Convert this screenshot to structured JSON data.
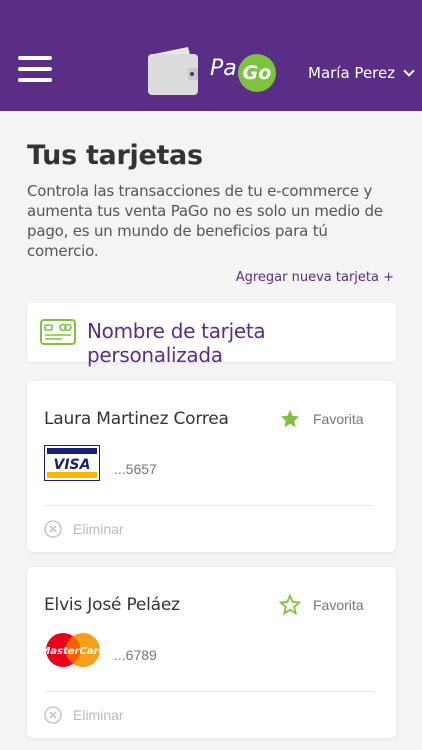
{
  "header": {
    "brand_pa": "Pa",
    "brand_go": "Go",
    "user_name": "María Perez"
  },
  "page": {
    "title": "Tus tarjetas",
    "intro": "Controla las transacciones de tu e-commerce y aumenta tus venta PaGo no es solo un medio de pago, es un mundo de beneficios para tú comercio.",
    "add_card_label": "Agregar nueva tarjeta +"
  },
  "section": {
    "label": "Nombre de tarjeta personalizada"
  },
  "cards": [
    {
      "holder": "Laura Martinez Correa",
      "brand": "VISA",
      "digits": "...5657",
      "favorite_label": "Favorita",
      "favorite": true,
      "remove_label": "Eliminar"
    },
    {
      "holder": "Elvis José Peláez",
      "brand": "MasterCard",
      "digits": "...6789",
      "favorite_label": "Favorita",
      "favorite": false,
      "remove_label": "Eliminar"
    }
  ],
  "colors": {
    "primary": "#5a2d86",
    "accent": "#7ec242",
    "background": "#f4f4f4"
  }
}
